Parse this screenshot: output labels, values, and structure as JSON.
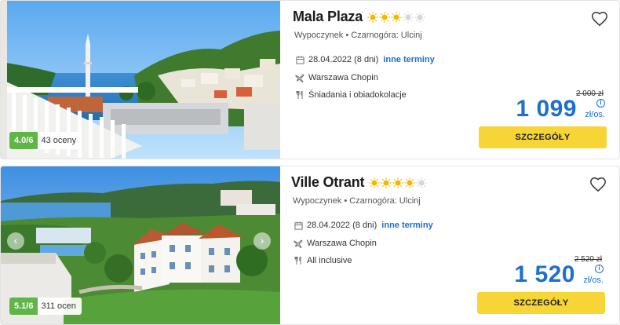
{
  "offers": [
    {
      "name": "Mala Plaza",
      "stars": 3,
      "location": "Wypoczynek • Czarnogóra: Ulcinj",
      "date": "28.04.2022 (8 dni)",
      "other_dates": "inne terminy",
      "departure": "Warszawa Chopin",
      "board": "Śniadania i obiadokolacje",
      "old_price": "2 000 zł",
      "price": "1 099",
      "per_person": "zł/os.",
      "button": "SZCZEGÓŁY",
      "score": "4.0/6",
      "reviews": "43 oceny"
    },
    {
      "name": "Ville Otrant",
      "stars": 4,
      "location": "Wypoczynek • Czarnogóra: Ulcinj",
      "date": "28.04.2022 (8 dni)",
      "other_dates": "inne terminy",
      "departure": "Warszawa Chopin",
      "board": "All inclusive",
      "old_price": "2 520 zł",
      "price": "1 520",
      "per_person": "zł/os.",
      "button": "SZCZEGÓŁY",
      "score": "5.1/6",
      "reviews": "311 ocen"
    }
  ],
  "colors": {
    "accent": "#1d6fd1",
    "button": "#f7d534",
    "rating": "#5fb546",
    "star": "#f5b800"
  }
}
